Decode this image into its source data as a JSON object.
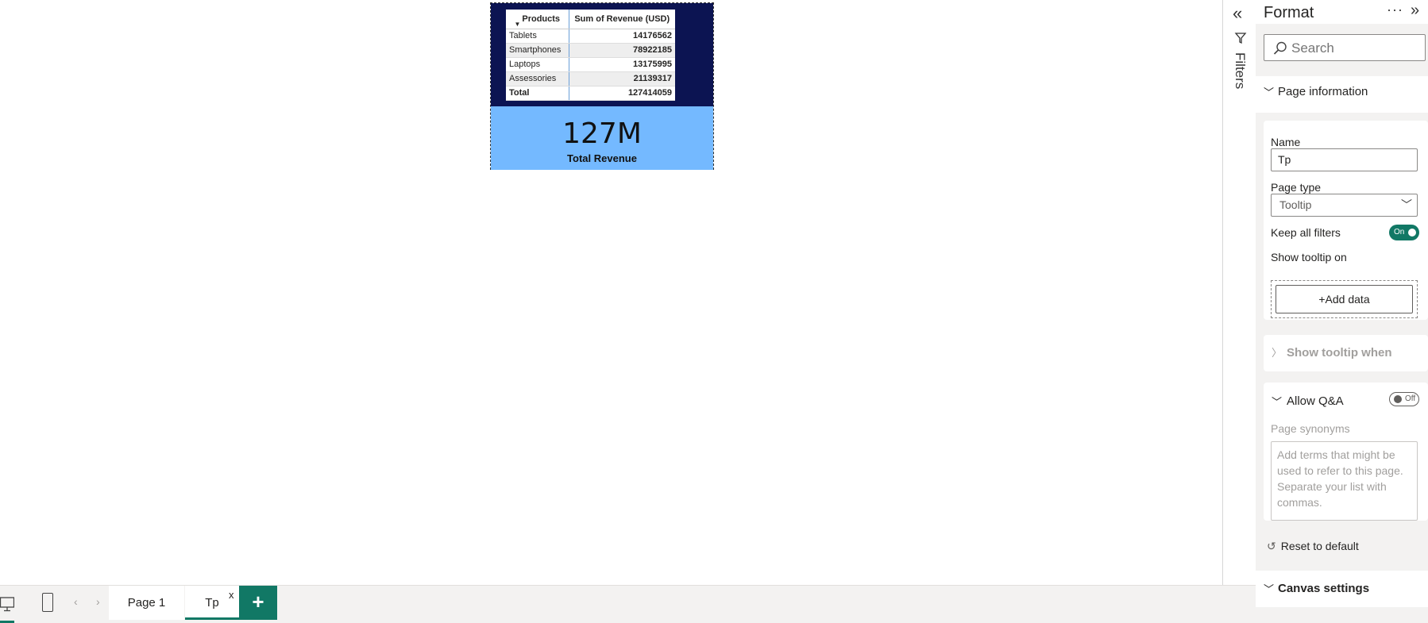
{
  "visual": {
    "table": {
      "headers": [
        "Products",
        "Sum of Revenue (USD)"
      ],
      "rows": [
        {
          "product": "Tablets",
          "revenue": "14176562"
        },
        {
          "product": "Smartphones",
          "revenue": "78922185"
        },
        {
          "product": "Laptops",
          "revenue": "13175995"
        },
        {
          "product": "Assessories",
          "revenue": "21139317"
        }
      ],
      "total": {
        "label": "Total",
        "revenue": "127414059"
      }
    },
    "card": {
      "value": "127M",
      "label": "Total Revenue"
    },
    "colors": {
      "table_bg": "#0c1452",
      "card_bg": "#74b9ff"
    }
  },
  "filters": {
    "label": "Filters",
    "collapse_icon": "double-chevron-left-icon",
    "funnel_icon": "funnel-icon"
  },
  "format_pane": {
    "title": "Format",
    "more_glyph": "···",
    "expand_glyph": "»",
    "search_placeholder": "Search",
    "page_information": {
      "title": "Page information",
      "name_label": "Name",
      "name_value": "Tp",
      "page_type_label": "Page type",
      "page_type_value": "Tooltip",
      "keep_filters_label": "Keep all filters",
      "keep_filters_toggle": "On",
      "show_tooltip_label": "Show tooltip on",
      "add_data_label": "+Add data"
    },
    "show_tooltip_when": {
      "title": "Show tooltip when"
    },
    "allow_qa": {
      "title": "Allow Q&A",
      "toggle": "Off",
      "synonyms_label": "Page synonyms",
      "synonyms_placeholder": "Add terms that might be used to refer to this page. Separate your list with commas."
    },
    "reset_label": "Reset to default",
    "canvas_settings": {
      "title": "Canvas settings"
    }
  },
  "tabs": {
    "pages": [
      "Page 1",
      "Tp"
    ],
    "active": "Tp",
    "close_glyph": "x",
    "add_glyph": "+"
  },
  "accent_color": "#117865"
}
